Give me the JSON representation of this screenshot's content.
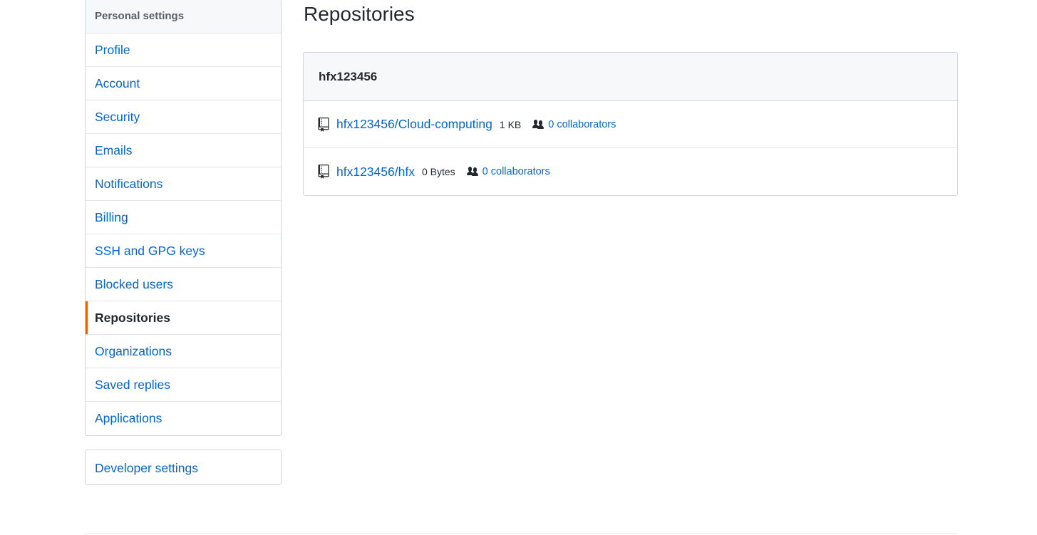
{
  "sidebar": {
    "heading": "Personal settings",
    "items": [
      {
        "label": "Profile"
      },
      {
        "label": "Account"
      },
      {
        "label": "Security"
      },
      {
        "label": "Emails"
      },
      {
        "label": "Notifications"
      },
      {
        "label": "Billing"
      },
      {
        "label": "SSH and GPG keys"
      },
      {
        "label": "Blocked users"
      },
      {
        "label": "Repositories"
      },
      {
        "label": "Organizations"
      },
      {
        "label": "Saved replies"
      },
      {
        "label": "Applications"
      }
    ],
    "selected": "Repositories",
    "developer_settings": "Developer settings"
  },
  "main": {
    "title": "Repositories",
    "owner": "hfx123456",
    "repos": [
      {
        "name": "hfx123456/Cloud-computing",
        "size": "1 KB",
        "collaborators": "0 collaborators"
      },
      {
        "name": "hfx123456/hfx",
        "size": "0 Bytes",
        "collaborators": "0 collaborators"
      }
    ]
  },
  "colors": {
    "link": "#0366d6",
    "selected_indicator": "#e36209",
    "header_bg": "#f6f8fa",
    "border": "#d1d5da"
  },
  "icons": {
    "repo": "repo-book-icon",
    "collaborators": "people-icon"
  }
}
